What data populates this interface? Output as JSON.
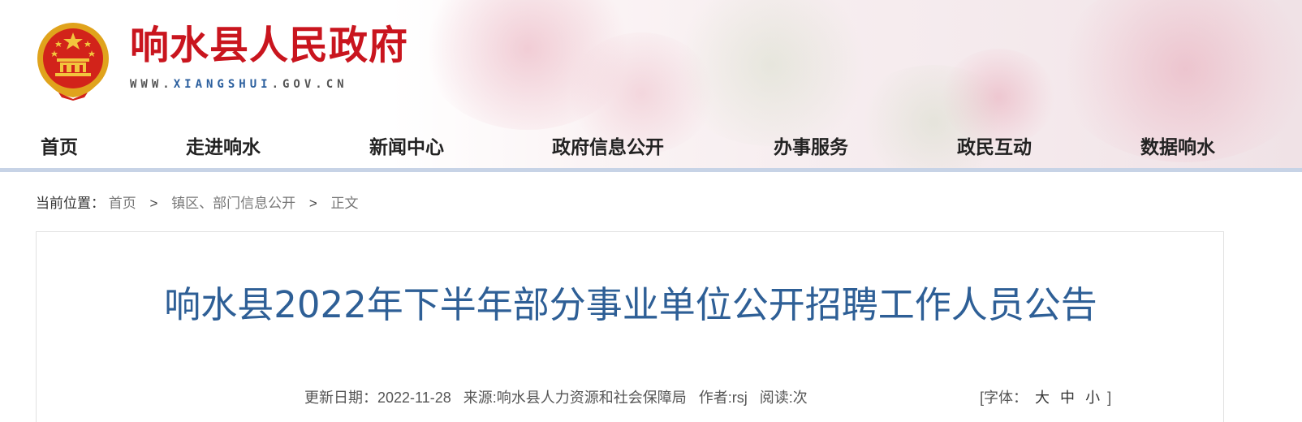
{
  "header": {
    "site_title": "响水县人民政府",
    "site_url_prefix": "WWW.",
    "site_url_highlight": "XIANGSHUI",
    "site_url_suffix": ".GOV.CN",
    "emblem_icon": "national-emblem-icon",
    "colors": {
      "title_red": "#c9151e",
      "url_blue": "#2b5f9e"
    }
  },
  "nav": {
    "items": [
      {
        "label": "首页"
      },
      {
        "label": "走进响水"
      },
      {
        "label": "新闻中心"
      },
      {
        "label": "政府信息公开"
      },
      {
        "label": "办事服务"
      },
      {
        "label": "政民互动"
      },
      {
        "label": "数据响水"
      }
    ],
    "rule_color": "#c7d3e6"
  },
  "breadcrumb": {
    "prefix": "当前位置：",
    "items": [
      "首页",
      "镇区、部门信息公开",
      "正文"
    ],
    "separator": ">"
  },
  "article": {
    "title": "响水县2022年下半年部分事业单位公开招聘工作人员公告",
    "title_color": "#2e5f96",
    "meta": {
      "update_date": "更新日期：2022-11-28",
      "source": "来源:响水县人力资源和社会保障局",
      "author": "作者:rsj",
      "reads": "阅读:次"
    },
    "font_size": {
      "open": "[字体：",
      "large": "大",
      "medium": "中",
      "small": "小",
      "close": "]"
    }
  }
}
